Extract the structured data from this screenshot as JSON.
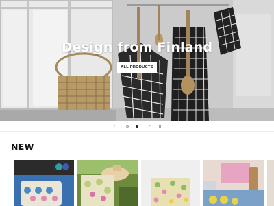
{
  "hero": {
    "title": "Design from Finland",
    "button_label": "All products"
  },
  "carousel": {
    "prev_icon": "‹",
    "next_icon": "›",
    "pause_icon": "❙❙",
    "slides": 2,
    "active_slide": 2
  },
  "new_section": {
    "title": "NEW"
  },
  "products": [
    {
      "name": "product-1",
      "icon": "product-image"
    },
    {
      "name": "product-2",
      "icon": "product-image"
    },
    {
      "name": "product-3",
      "icon": "product-image"
    },
    {
      "name": "product-4",
      "icon": "product-image"
    },
    {
      "name": "product-5",
      "icon": "product-image"
    }
  ],
  "colors": {
    "accent": "#111111",
    "background": "#ffffff"
  }
}
